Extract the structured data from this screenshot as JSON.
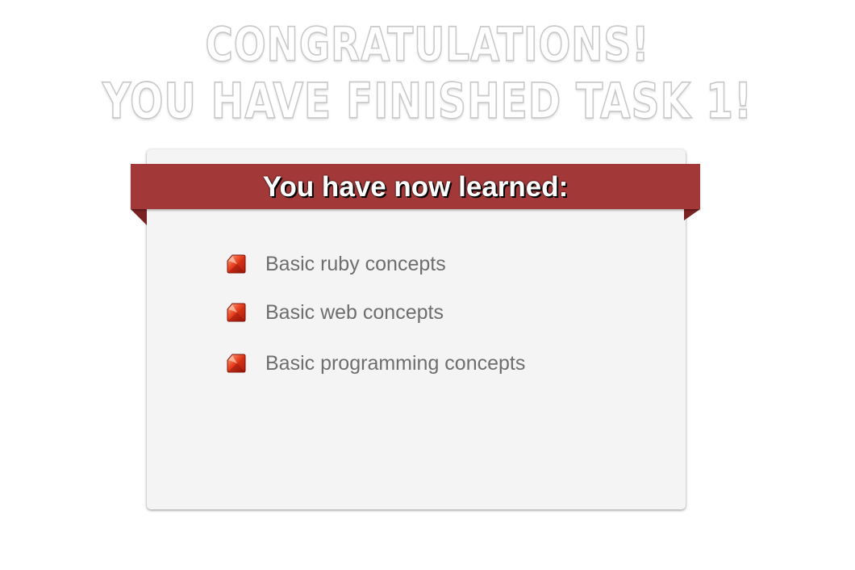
{
  "headline": {
    "line1": "CONGRATULATIONS!",
    "line2": "YOU HAVE FINISHED TASK 1!"
  },
  "card": {
    "ribbon_title": "You have now learned:",
    "items": [
      {
        "label": "Basic ruby concepts",
        "icon": "ruby-gem-icon"
      },
      {
        "label": "Basic web concepts",
        "icon": "ruby-gem-icon"
      },
      {
        "label": "Basic programming concepts",
        "icon": "ruby-gem-icon"
      }
    ]
  },
  "colors": {
    "ribbon": "#a33838",
    "card_background": "#f4f4f4",
    "item_text": "#6e6e6e"
  }
}
